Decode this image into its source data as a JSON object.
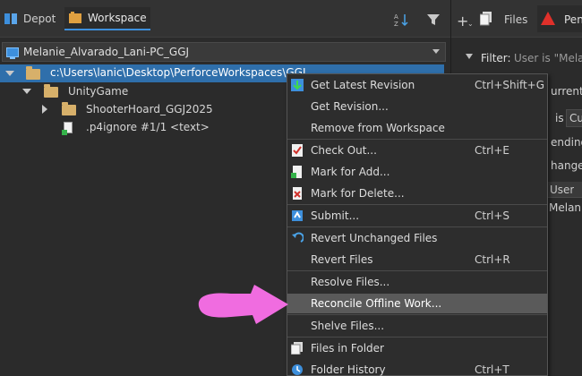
{
  "left_tabs": {
    "depot": "Depot",
    "workspace": "Workspace"
  },
  "workspace_selector": {
    "value": "Melanie_Alvarado_Lani-PC_GGJ"
  },
  "tree": {
    "root": "c:\\Users\\lanic\\Desktop\\PerforceWorkspaces\\GGJ",
    "unity": "UnityGame",
    "shooter": "ShooterHoard_GGJ2025",
    "ignore": ".p4ignore #1/1 <text>"
  },
  "right_panel": {
    "files_tab": "Files",
    "pending_tab": "Pen",
    "filter_label": "Filter:",
    "filter_value": "User is \"Melani",
    "current_user": "urrent U",
    "is_label": "is",
    "is_value": "Cu",
    "pending": "ending",
    "changelist": "hangeli",
    "col_user": "User",
    "row_user": "Melanie"
  },
  "context_menu": {
    "items": [
      {
        "label": "Get Latest Revision",
        "shortcut": "Ctrl+Shift+G"
      },
      {
        "label": "Get Revision...",
        "shortcut": ""
      },
      {
        "label": "Remove from Workspace",
        "shortcut": ""
      },
      {
        "label": "Check Out...",
        "shortcut": "Ctrl+E"
      },
      {
        "label": "Mark for Add...",
        "shortcut": ""
      },
      {
        "label": "Mark for Delete...",
        "shortcut": ""
      },
      {
        "label": "Submit...",
        "shortcut": "Ctrl+S"
      },
      {
        "label": "Revert Unchanged Files",
        "shortcut": ""
      },
      {
        "label": "Revert Files",
        "shortcut": "Ctrl+R"
      },
      {
        "label": "Resolve Files...",
        "shortcut": ""
      },
      {
        "label": "Reconcile Offline Work...",
        "shortcut": ""
      },
      {
        "label": "Shelve Files...",
        "shortcut": ""
      },
      {
        "label": "Files in Folder",
        "shortcut": ""
      },
      {
        "label": "Folder History",
        "shortcut": "Ctrl+T"
      }
    ]
  },
  "colors": {
    "selection": "#2f6fab",
    "menu_highlight": "#5a5a5a",
    "annotation_arrow": "#f06ce0"
  }
}
